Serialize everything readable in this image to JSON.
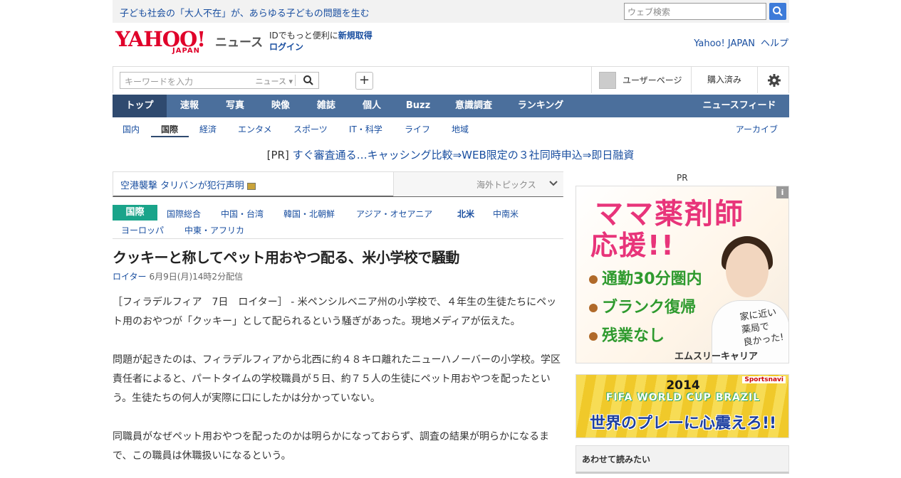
{
  "topbar": {
    "headline": "子ども社会の「大人不在」が、あらゆる子どもの問題を生む",
    "search_placeholder": "ウェブ検索"
  },
  "header": {
    "logo_text": "YAHOO!",
    "logo_sub": "JAPAN",
    "section_name": "ニュース",
    "id_promo": "IDでもっと便利に",
    "register": "新規取得",
    "login": "ログイン",
    "links": [
      "Yahoo! JAPAN",
      "ヘルプ"
    ]
  },
  "toolbar": {
    "keyword_placeholder": "キーワードを入力",
    "scope": "ニュース",
    "add_label": "+",
    "user_page": "ユーザーページ",
    "purchased": "購入済み"
  },
  "main_nav": {
    "items": [
      "トップ",
      "速報",
      "写真",
      "映像",
      "雑誌",
      "個人",
      "Buzz",
      "意識調査",
      "ランキング"
    ],
    "right": "ニュースフィード",
    "active": "トップ"
  },
  "sub_nav": {
    "items": [
      "国内",
      "国際",
      "経済",
      "エンタメ",
      "スポーツ",
      "IT・科学",
      "ライフ",
      "地域"
    ],
    "active": "国際",
    "archive": "アーカイブ"
  },
  "pr_banner": {
    "tag": "[PR]",
    "text": "すぐ審査通る…キャッシング比較⇒WEB限定の３社同時申込⇒即日融資"
  },
  "topic_box": {
    "headline": "空港襲撃 タリバンが犯行声明",
    "right_label": "海外トピックス"
  },
  "categories": {
    "badge": "国際",
    "items": [
      "国際総合",
      "中国・台湾",
      "韓国・北朝鮮",
      "アジア・オセアニア",
      "北米",
      "中南米",
      "ヨーロッパ",
      "中東・アフリカ"
    ],
    "active": "北米"
  },
  "article": {
    "title": "クッキーと称してペット用おやつ配る、米小学校で騒動",
    "source": "ロイター",
    "date": "6月9日(月)14時2分配信",
    "paragraphs": [
      "［フィラデルフィア　7日　ロイター］ - 米ペンシルベニア州の小学校で、４年生の生徒たちにペット用のおやつが「クッキー」として配られるという騒ぎがあった。現地メディアが伝えた。",
      "問題が起きたのは、フィラデルフィアから北西に約４８キロ離れたニューハノーバーの小学校。学区責任者によると、パートタイムの学校職員が５日、約７５人の生徒にペット用おやつを配ったという。生徒たちの何人が実際に口にしたかは分かっていない。",
      "同職員がなぜペット用おやつを配ったのかは明らかになっておらず、調査の結果が明らかになるまで、この職員は休職扱いになるという。"
    ]
  },
  "sidebar": {
    "pr_label": "PR",
    "ad1": {
      "info": "i",
      "line1": "ママ薬剤師",
      "line2": "応援!!",
      "points": [
        "通勤30分圏内",
        "ブランク復帰",
        "残業なし"
      ],
      "handwritten": [
        "家に近い",
        "薬局で",
        "良かった!"
      ],
      "brand": "エムスリーキャリア"
    },
    "ad2": {
      "logo": "Sportsnavi",
      "year": "2014",
      "event": "FIFA WORLD CUP BRAZIL",
      "slogan": "世界のプレーに心震えろ!!"
    },
    "related_title": "あわせて読みたい"
  },
  "colors": {
    "nav_bg": "#4b6f9c",
    "nav_active": "#2f4a6f",
    "link": "#1a4fa0",
    "category_badge": "#1aa48a",
    "yahoo_red": "#e0002a"
  }
}
